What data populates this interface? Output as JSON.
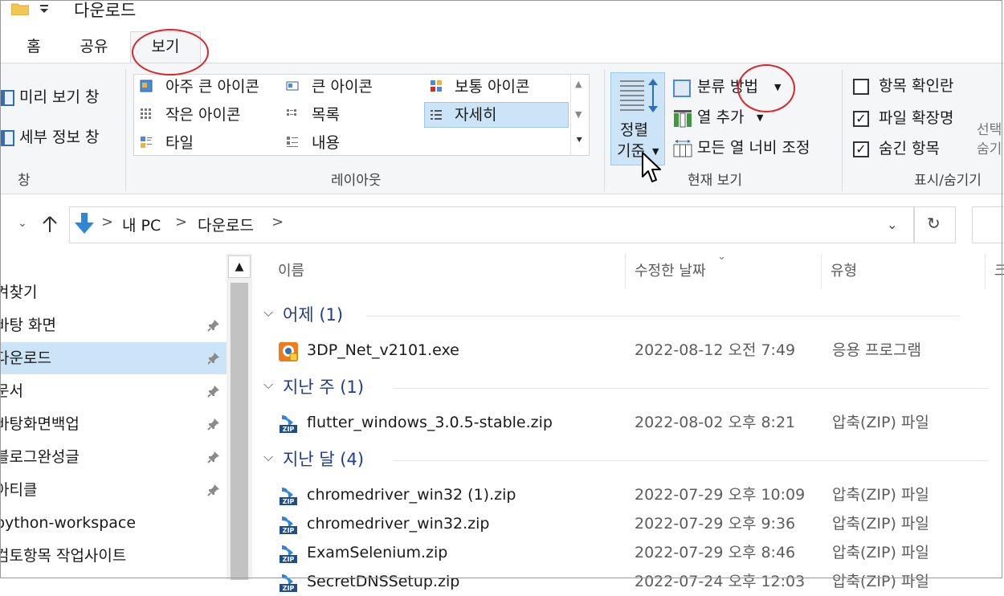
{
  "window": {
    "title": "다운로드"
  },
  "tabs": [
    {
      "label": "홈"
    },
    {
      "label": "공유"
    },
    {
      "label": "보기"
    }
  ],
  "ribbon": {
    "panes": {
      "preview": "미리 보기 창",
      "details": "세부 정보 창",
      "group_label": "창"
    },
    "layout": {
      "items": [
        "아주 큰 아이콘",
        "큰 아이콘",
        "보통 아이콘",
        "작은 아이콘",
        "목록",
        "자세히",
        "타일",
        "내용"
      ],
      "selected": "자세히",
      "group_label": "레이아웃"
    },
    "current_view": {
      "sort_by_line1": "정렬",
      "sort_by_line2": "기준",
      "group_by": "분류 방법",
      "add_columns": "열 추가",
      "fit_columns": "모든 열 너비 조정",
      "group_label": "현재 보기"
    },
    "show_hide": {
      "item_checkboxes": "항목 확인란",
      "item_checkboxes_checked": false,
      "file_extensions": "파일 확장명",
      "file_extensions_checked": true,
      "hidden_items": "숨긴 항목",
      "hidden_items_checked": true,
      "clipped_1": "선택",
      "clipped_2": "숨기",
      "group_label": "표시/숨기기"
    }
  },
  "address": {
    "sep": ">",
    "crumbs": [
      "내 PC",
      "다운로드"
    ]
  },
  "nav": {
    "items": [
      {
        "label": "겨찾기",
        "pinned": false
      },
      {
        "label": "바탕 화면",
        "pinned": true
      },
      {
        "label": "다운로드",
        "pinned": true,
        "selected": true
      },
      {
        "label": "문서",
        "pinned": true
      },
      {
        "label": "바탕화면백업",
        "pinned": true
      },
      {
        "label": "블로그완성글",
        "pinned": true
      },
      {
        "label": "아티클",
        "pinned": true
      },
      {
        "label": "python-workspace",
        "pinned": false
      },
      {
        "label": "검토항목 작업사이트",
        "pinned": false
      }
    ]
  },
  "filelist": {
    "columns": {
      "name": "이름",
      "date": "수정한 날짜",
      "type": "유형",
      "clipped": "크"
    },
    "groups": [
      {
        "label": "어제 (1)",
        "files": [
          {
            "name": "3DP_Net_v2101.exe",
            "date": "2022-08-12 오전 7:49",
            "type": "응용 프로그램",
            "icon": "exe-app-icon"
          }
        ]
      },
      {
        "label": "지난 주 (1)",
        "files": [
          {
            "name": "flutter_windows_3.0.5-stable.zip",
            "date": "2022-08-02 오후 8:21",
            "type": "압축(ZIP) 파일",
            "icon": "zip-icon"
          }
        ]
      },
      {
        "label": "지난 달 (4)",
        "files": [
          {
            "name": "chromedriver_win32 (1).zip",
            "date": "2022-07-29 오후 10:09",
            "type": "압축(ZIP) 파일",
            "icon": "zip-icon"
          },
          {
            "name": "chromedriver_win32.zip",
            "date": "2022-07-29 오후 9:36",
            "type": "압축(ZIP) 파일",
            "icon": "zip-icon"
          },
          {
            "name": "ExamSelenium.zip",
            "date": "2022-07-29 오후 8:46",
            "type": "압축(ZIP) 파일",
            "icon": "zip-icon"
          },
          {
            "name": "SecretDNSSetup.zip",
            "date": "2022-07-24 오후 12:03",
            "type": "압축(ZIP) 파일",
            "icon": "zip-icon"
          }
        ]
      }
    ]
  },
  "colors": {
    "accent": "#1e3d8f",
    "selection": "#cce4f7",
    "annotation": "#d9262b"
  }
}
